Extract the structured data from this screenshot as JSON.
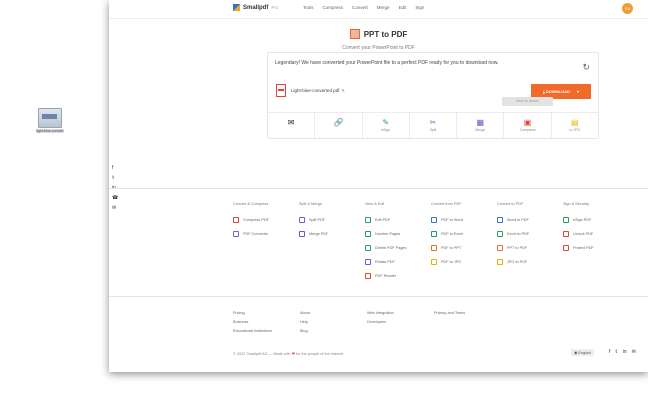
{
  "desktop": {
    "file_icon_label": "light-blue-convert"
  },
  "header": {
    "logo_text": "Smallpdf",
    "logo_badge": "Pro",
    "nav": [
      "Tools",
      "Compress",
      "Convert",
      "Merge",
      "Edit",
      "Sign"
    ],
    "avatar": "RA"
  },
  "hero": {
    "title": "PPT to PDF",
    "subtitle": "Convert your PowerPoint to PDF"
  },
  "result": {
    "message": "Legendary! We have converted your PowerPoint file to a perfect PDF ready for you to download now.",
    "file_name": "Light-blue-converted.pdf",
    "download_label": "DOWNLOAD",
    "tooltip": "Save to device"
  },
  "tools": [
    {
      "icon": "mail-icon",
      "label": ""
    },
    {
      "icon": "link-icon",
      "label": ""
    },
    {
      "icon": "esign-icon",
      "label": "eSign"
    },
    {
      "icon": "split-icon",
      "label": "Split"
    },
    {
      "icon": "merge-icon",
      "label": "Merge"
    },
    {
      "icon": "compress-icon",
      "label": "Compress"
    },
    {
      "icon": "to-jpg-icon",
      "label": "to JPG"
    }
  ],
  "footer": {
    "columns": [
      {
        "heading": "Convert & Compress",
        "items": [
          "Compress PDF",
          "PDF Converter"
        ]
      },
      {
        "heading": "Split & Merge",
        "items": [
          "Split PDF",
          "Merge PDF"
        ]
      },
      {
        "heading": "View & Edit",
        "items": [
          "Edit PDF",
          "Number Pages",
          "Delete PDF Pages",
          "Rotate PDF",
          "PDF Reader"
        ]
      },
      {
        "heading": "Convert from PDF",
        "items": [
          "PDF to Word",
          "PDF to Excel",
          "PDF to PPT",
          "PDF to JPG"
        ]
      },
      {
        "heading": "Convert to PDF",
        "items": [
          "Word to PDF",
          "Excel to PDF",
          "PPT to PDF",
          "JPG to PDF"
        ]
      },
      {
        "heading": "Sign & Security",
        "items": [
          "eSign PDF",
          "Unlock PDF",
          "Protect PDF"
        ]
      }
    ],
    "links": [
      [
        "Pricing",
        "Business",
        "Educational Institutions"
      ],
      [
        "About",
        "Help",
        "Blog"
      ],
      [
        "Web Integration",
        "Developers"
      ],
      [
        "Privacy and Terms"
      ]
    ],
    "copyright_pre": "© 2022 Smallpdf AG — Made with",
    "copyright_post": "for the people of the internet",
    "language": "English"
  }
}
